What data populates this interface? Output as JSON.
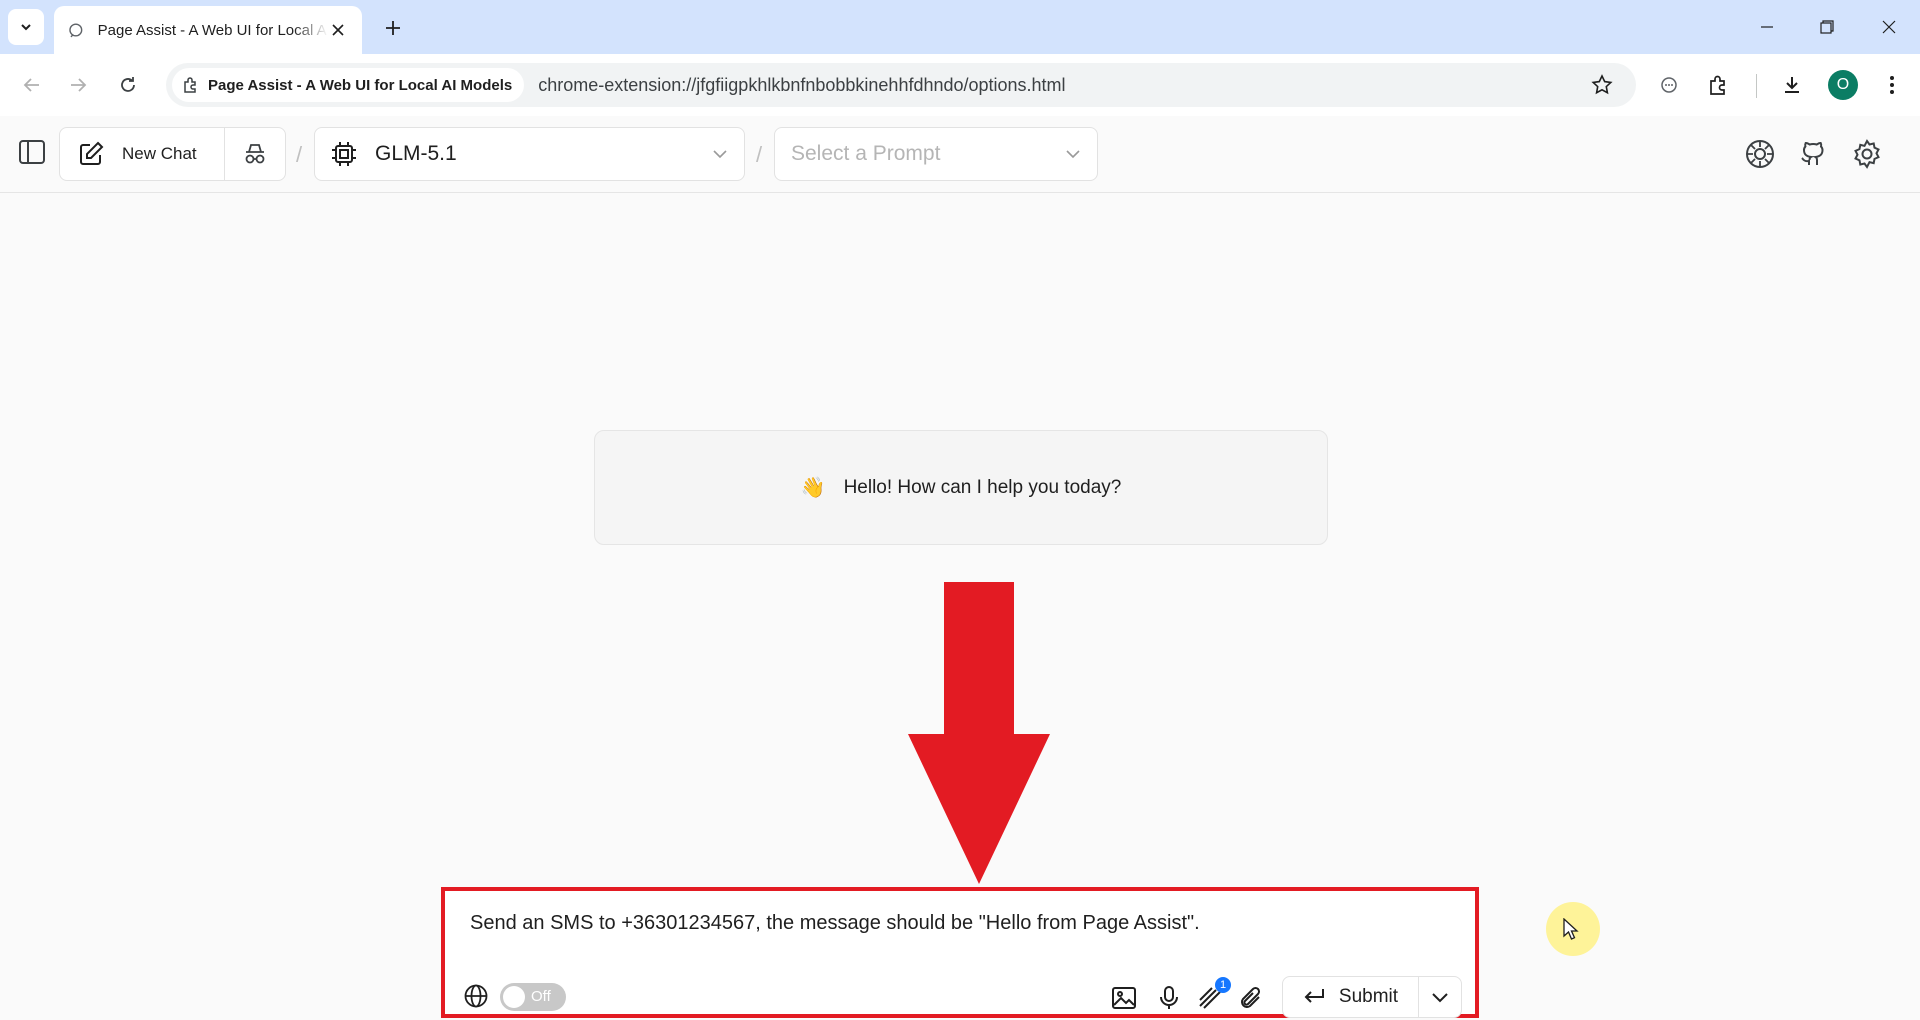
{
  "browser": {
    "tab_title": "Page Assist - A Web UI for Local AI Models",
    "site_chip": "Page Assist - A Web UI for Local AI Models",
    "url": "chrome-extension://jfgfiigpkhlkbnfnbobbkinehhfdhndo/options.html",
    "profile_initial": "O"
  },
  "header": {
    "new_chat_label": "New Chat",
    "slash": "/",
    "model": "GLM-5.1",
    "prompt_placeholder": "Select a Prompt"
  },
  "main": {
    "greeting_emoji": "👋",
    "greeting": "Hello! How can I help you today?"
  },
  "composer": {
    "message": "Send an SMS to +36301234567, the message should be \"Hello from Page Assist\".",
    "web_search_toggle": "Off",
    "attachment_badge": "1",
    "submit_label": "Submit"
  },
  "colors": {
    "accent_red": "#e31b23",
    "chrome_tabstrip": "#d3e3fd",
    "badge_blue": "#1677ff",
    "profile_green": "#0b7d64"
  },
  "icons": [
    "chevron-down-icon",
    "chat-bubble-icon",
    "close-icon",
    "plus-icon",
    "minimize-icon",
    "restore-icon",
    "back-icon",
    "forward-icon",
    "reload-icon",
    "extension-icon",
    "star-icon",
    "download-icon",
    "more-icon",
    "sidebar-icon",
    "edit-icon",
    "incognito-icon",
    "cpu-icon",
    "ollama-icon",
    "github-icon",
    "settings-icon",
    "globe-icon",
    "image-icon",
    "mic-icon",
    "knowledge-icon",
    "paperclip-icon",
    "enter-icon"
  ]
}
